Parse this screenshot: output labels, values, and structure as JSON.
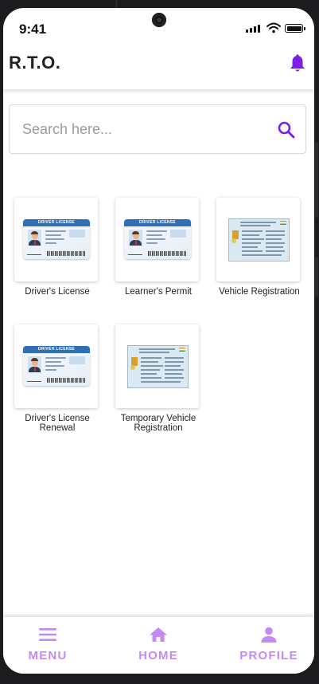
{
  "status": {
    "time": "9:41"
  },
  "appbar": {
    "title": "R.T.O.",
    "notification_icon": "bell-icon"
  },
  "search": {
    "placeholder": "Search here...",
    "value": "",
    "icon": "search-icon"
  },
  "services": [
    {
      "label": "Driver's License",
      "image": "driver-license-card"
    },
    {
      "label": "Learner's Permit",
      "image": "driver-license-card"
    },
    {
      "label": "Vehicle Registration",
      "image": "registration-certificate"
    },
    {
      "label": "Driver's License Renewal",
      "image": "driver-license-card"
    },
    {
      "label": "Temporary Vehicle Registration",
      "image": "registration-certificate"
    }
  ],
  "license_card_header": "DRIVER LICENSE",
  "bottom_nav": [
    {
      "label": "MENU",
      "icon": "menu-icon"
    },
    {
      "label": "HOME",
      "icon": "home-icon"
    },
    {
      "label": "PROFILE",
      "icon": "profile-icon"
    }
  ],
  "colors": {
    "accent": "#7b1fe6",
    "nav_inactive": "#c38af5",
    "frame": "#1c1c1e"
  }
}
